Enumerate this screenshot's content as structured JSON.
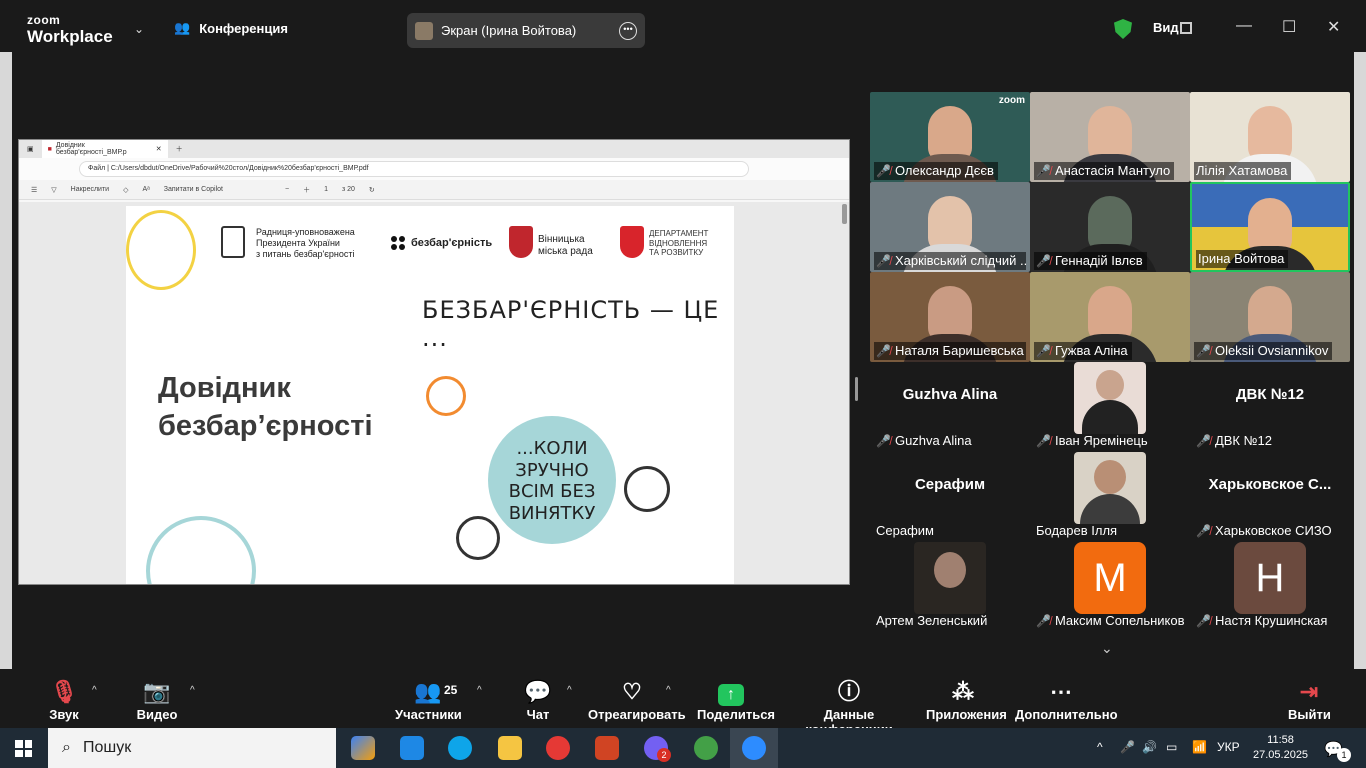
{
  "app": {
    "logo_top": "zoom",
    "logo_bottom": "Workplace",
    "meeting_label": "Конференция",
    "share_pill_label": "Экран (Ірина Войтова)",
    "view_label": "Вид"
  },
  "browser": {
    "tab_title": "Довідник безбар'єрності_ВМР.p",
    "address": "Файл  |  C:/Users/dbdut/OneDrive/Рабочий%20стол/Довідник%20безбар'єрності_ВМР.pdf",
    "tool_draw": "Накреслити",
    "tool_copilot": "Запитати в Copilot",
    "page_current": "1",
    "page_total": "з 20"
  },
  "pdf": {
    "org1": "Радниця-уповноважена\nПрезидента України\nз питань безбар'єрності",
    "org2": "безбар'єрність",
    "org3": "Вінницька\nміська рада",
    "org4": "ДЕПАРТАМЕНТ\nВІДНОВЛЕННЯ\nТА РОЗВИТКУ",
    "title": "Довідник\nбезбар’єрності",
    "slogan": "БЕЗБАР'ЄРНІСТЬ — ЦЕ ...",
    "circle_text": "...КОЛИ\nЗРУЧНО\nВСІМ БЕЗ\nВИНЯТКУ"
  },
  "participants": [
    {
      "name": "Олександр Дєєв",
      "muted": true
    },
    {
      "name": "Анастасія Мантуло",
      "muted": true
    },
    {
      "name": "Лілія Хатамова",
      "muted": false
    },
    {
      "name": "Харківський слідчий ...",
      "muted": true
    },
    {
      "name": "Геннадій Івлєв",
      "muted": true
    },
    {
      "name": "Ірина Войтова",
      "muted": false
    },
    {
      "name": "Наталя Баришевська",
      "muted": true
    },
    {
      "name": "Гужва Аліна",
      "muted": true
    },
    {
      "name": "Oleksii Ovsiannikov",
      "muted": true
    },
    {
      "name": "Guzhva Alina",
      "muted": true,
      "display": "Guzhva Alina"
    },
    {
      "name": "Іван Яремінець",
      "muted": true
    },
    {
      "name": "ДВК №12",
      "muted": true,
      "display": "ДВК №12"
    },
    {
      "name": "Серафим",
      "muted": false,
      "display": "Серафим"
    },
    {
      "name": "Бодарев Ілля",
      "muted": false
    },
    {
      "name": "Харьковское СИЗО",
      "muted": true,
      "display": "Харьковское С..."
    },
    {
      "name": "Артем Зеленський",
      "muted": false
    },
    {
      "name": "Максим Сопельников",
      "muted": true,
      "letter": "M"
    },
    {
      "name": "Настя Крушинская",
      "muted": true,
      "letter": "H"
    }
  ],
  "toolbar": {
    "audio": "Звук",
    "video": "Видео",
    "participants": "Участники",
    "participants_count": "25",
    "chat": "Чат",
    "react": "Отреагировать",
    "share": "Поделиться",
    "info": "Данные конференции",
    "apps": "Приложения",
    "more": "Дополнительно",
    "leave": "Выйти"
  },
  "taskbar": {
    "search": "Пошук",
    "lang": "УКР",
    "time": "11:58",
    "date": "27.05.2025",
    "viber_badge": "2",
    "notif_badge": "1"
  },
  "colors": {
    "accent_green": "#22c55e",
    "mute_red": "#e5484d",
    "leave_red": "#e5484d"
  }
}
